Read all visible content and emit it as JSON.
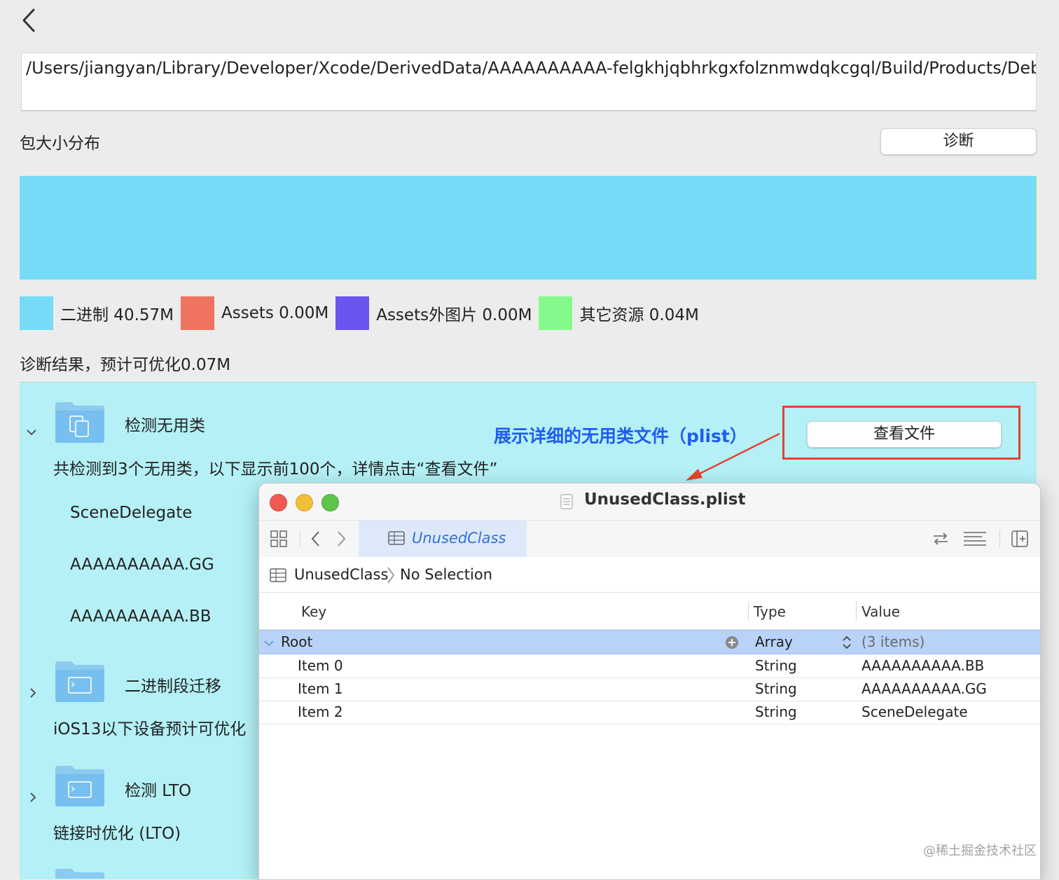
{
  "path": "/Users/jiangyan/Library/Developer/Xcode/DerivedData/AAAAAAAAAA-felgkhjqbhrkgxfolznmwdqkcgql/Build/Products/Debug-iphone",
  "size_section": {
    "title": "包大小分布",
    "diagnose_button": "诊断"
  },
  "size_bar": [
    {
      "name": "binary",
      "fraction": 0.999,
      "color": "#76dbf7"
    },
    {
      "name": "assets",
      "fraction": 0.0,
      "color": "#ee7360"
    },
    {
      "name": "assets-external-images",
      "fraction": 0.0,
      "color": "#6b55f0"
    },
    {
      "name": "other",
      "fraction": 0.001,
      "color": "#86f98c"
    }
  ],
  "legend": [
    {
      "label": "二进制 40.57M",
      "color": "#76dbf7"
    },
    {
      "label": "Assets 0.00M",
      "color": "#ee7360"
    },
    {
      "label": "Assets外图片 0.00M",
      "color": "#6b55f0"
    },
    {
      "label": "其它资源 0.04M",
      "color": "#86f98c"
    }
  ],
  "diagnosis": {
    "title": "诊断结果，预计可优化0.07M",
    "items": [
      {
        "title": "检测无用类",
        "description": "共检测到3个无用类，以下显示前100个，详情点击“查看文件”",
        "expanded": true,
        "classes": [
          "SceneDelegate",
          "AAAAAAAAAA.GG",
          "AAAAAAAAAA.BB"
        ],
        "button": "查看文件"
      },
      {
        "title": "二进制段迁移",
        "description": "iOS13以下设备预计可优化",
        "expanded": false
      },
      {
        "title": "检测 LTO",
        "description": "链接时优化 (LTO)",
        "expanded": false
      }
    ]
  },
  "annotation": {
    "text": "展示详细的无用类文件（plist）",
    "color": "#1f5cf0",
    "box_color": "#e2442f"
  },
  "plist_window": {
    "title": "UnusedClass.plist",
    "tab": "UnusedClass",
    "breadcrumb": {
      "root": "UnusedClass",
      "selection": "No Selection"
    },
    "columns": {
      "key": "Key",
      "type": "Type",
      "value": "Value"
    },
    "rows": [
      {
        "key": "Root",
        "type": "Array",
        "value": "(3 items)"
      },
      {
        "key": "Item 0",
        "type": "String",
        "value": "AAAAAAAAAA.BB"
      },
      {
        "key": "Item 1",
        "type": "String",
        "value": "AAAAAAAAAA.GG"
      },
      {
        "key": "Item 2",
        "type": "String",
        "value": "SceneDelegate"
      }
    ]
  },
  "watermark": "@稀土掘金技术社区"
}
